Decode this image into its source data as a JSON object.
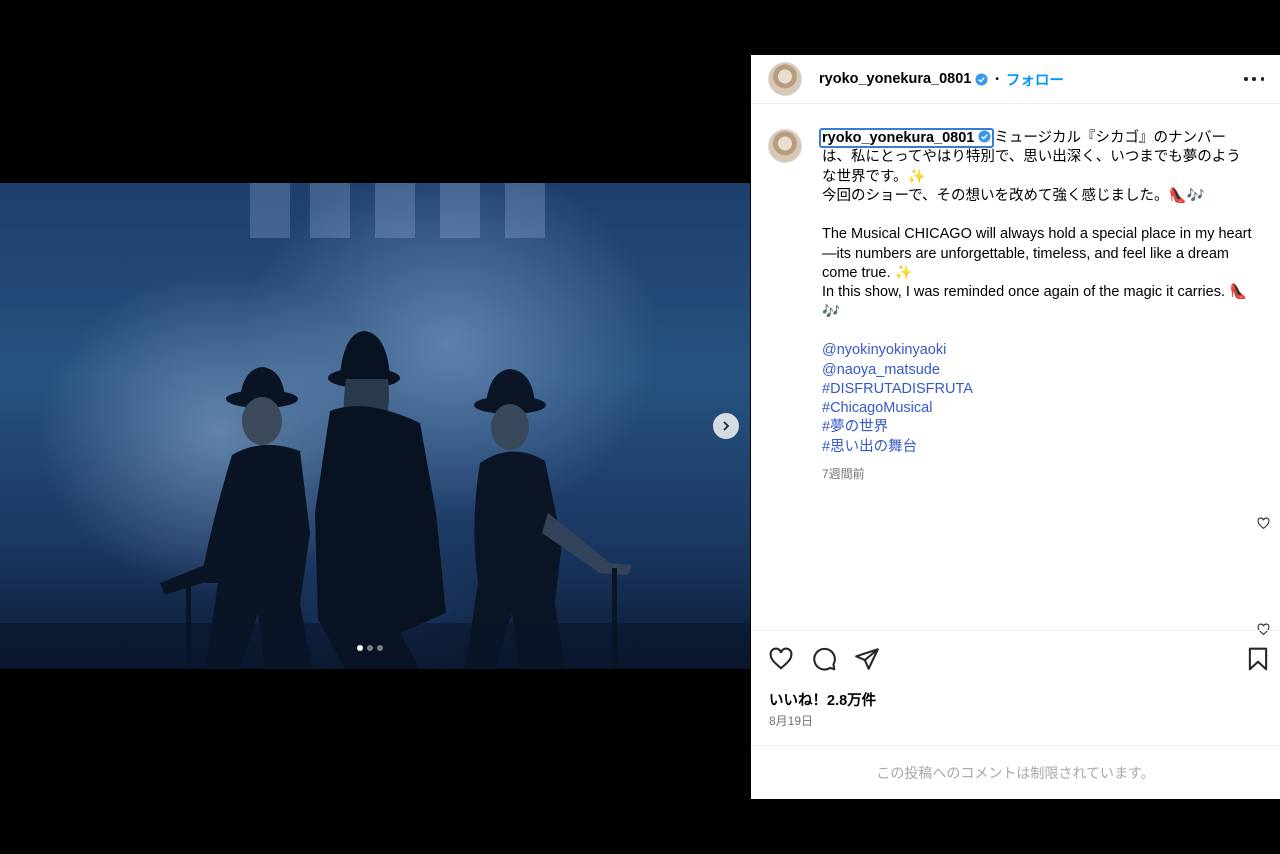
{
  "post": {
    "username": "ryoko_yonekura_0801",
    "separator": "•",
    "follow_label": "フォロー"
  },
  "caption": {
    "jp_line1": "ミュージカル『シカゴ』のナンバーは、私にとってやはり特別で、思い出深く、いつまでも夢のような世界です。",
    "jp_line2": "今回のショーで、その想いを改めて強く感じました。",
    "en_line1": "The Musical CHICAGO will always hold a special place in my heart—its numbers are unforgettable, timeless, and feel like a dream come true.",
    "en_line2": "In this show, I was reminded once again of the magic it carries.",
    "sparkle": "✨",
    "emoji_shoe_music": "👠🎶",
    "tags": [
      "@nyokinyokinyaoki",
      "@naoya_matsude",
      "#DISFRUTADISFRUTA",
      "#ChicagoMusical",
      "#夢の世界",
      "#思い出の舞台"
    ],
    "time_ago": "7週間前"
  },
  "likes_label": "いいね！2.8万件",
  "date_label": "8月19日",
  "comments_disabled": "この投稿へのコメントは制限されています。",
  "carousel": {
    "total": 3,
    "current": 1
  },
  "colors": {
    "follow": "#0095f6",
    "hashtag": "#3559c7",
    "verified": "#3897f0",
    "mention_outline": "#3b7bd8"
  },
  "icons": [
    "more-icon",
    "verified-icon",
    "next-arrow-icon",
    "heart-icon",
    "comment-icon",
    "share-icon",
    "bookmark-icon"
  ]
}
